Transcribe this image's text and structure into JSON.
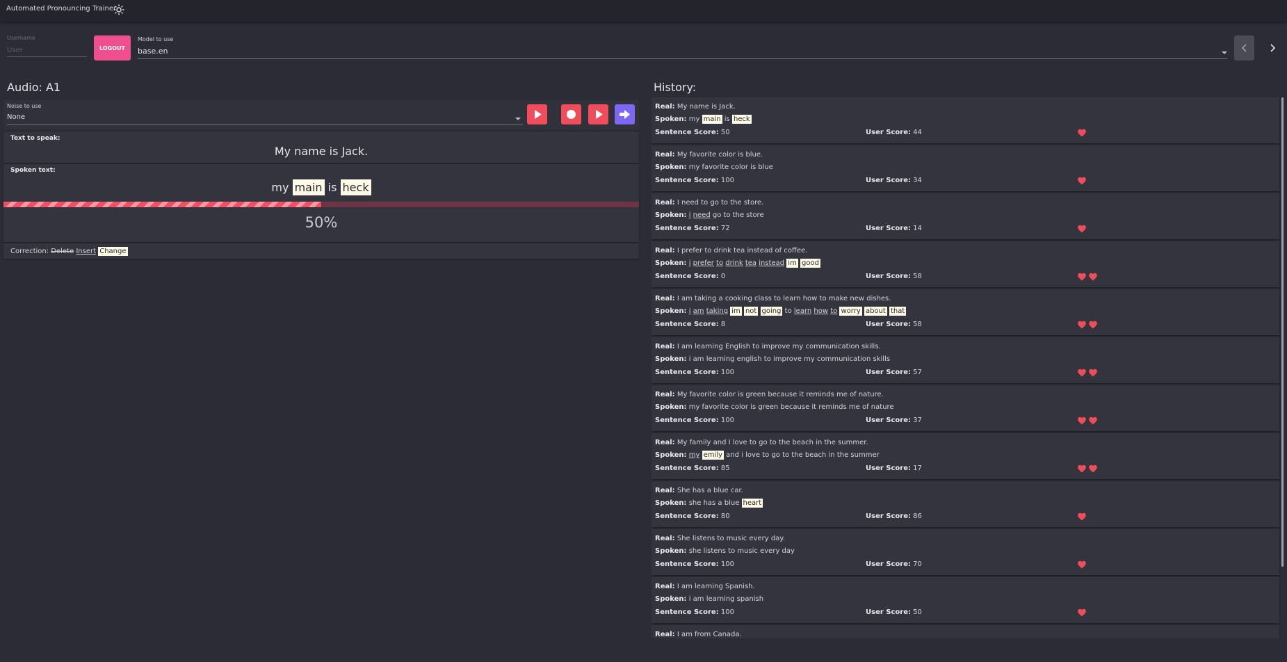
{
  "app": {
    "title": "Automated Pronouncing Trainer",
    "theme_icon": "sun-icon"
  },
  "header": {
    "username_label": "Username",
    "username_placeholder": "User",
    "logout_label": "LOGOUT",
    "model_label": "Model to use",
    "model_value": "base.en",
    "prev_icon": "chevron-left-icon",
    "next_icon": "chevron-right-icon"
  },
  "audio": {
    "title": "Audio: A1",
    "noise_label": "Noise to use",
    "noise_value": "None",
    "buttons": [
      "play-icon",
      "record-icon",
      "play-icon",
      "next-arrow-icon"
    ],
    "text_to_speak_label": "Text to speak:",
    "text_to_speak": "My name is Jack.",
    "spoken_label": "Spoken text:",
    "spoken_words": [
      {
        "text": "my",
        "style": "plain"
      },
      {
        "text": "main",
        "style": "change"
      },
      {
        "text": "is",
        "style": "plain"
      },
      {
        "text": "heck",
        "style": "change"
      }
    ],
    "progress": 50,
    "progress_label": "50%",
    "correction_label": "Correction:",
    "correction_delete": "Delete",
    "correction_insert": "Insert",
    "correction_change": "Change"
  },
  "history": {
    "title": "History:",
    "real_label": "Real:",
    "spoken_label": "Spoken:",
    "sentence_score_label": "Sentence Score:",
    "user_score_label": "User Score:",
    "colors": {
      "heart": "#f04c5c",
      "highlight": "#fffbe8"
    },
    "items": [
      {
        "real": "My name is Jack.",
        "spoken": [
          [
            "my",
            "plain"
          ],
          [
            "main",
            "change"
          ],
          [
            "is",
            "plain"
          ],
          [
            "heck",
            "change"
          ]
        ],
        "sentence_score": "50",
        "user_score": "44",
        "hearts": 1
      },
      {
        "real": "My favorite color is blue.",
        "spoken": [
          [
            "my favorite color is blue",
            "plain"
          ]
        ],
        "sentence_score": "100",
        "user_score": "34",
        "hearts": 1
      },
      {
        "real": "I need to go to the store.",
        "spoken": [
          [
            "i",
            "insert"
          ],
          [
            "need",
            "insert"
          ],
          [
            "go to the store",
            "plain"
          ]
        ],
        "sentence_score": "72",
        "user_score": "14",
        "hearts": 1
      },
      {
        "real": "I prefer to drink tea instead of coffee.",
        "spoken": [
          [
            "i",
            "insert"
          ],
          [
            "prefer",
            "insert"
          ],
          [
            "to",
            "insert"
          ],
          [
            "drink",
            "insert"
          ],
          [
            "tea",
            "insert"
          ],
          [
            "instead",
            "insert"
          ],
          [
            "im",
            "change"
          ],
          [
            "good",
            "change"
          ]
        ],
        "sentence_score": "0",
        "user_score": "58",
        "hearts": 2
      },
      {
        "real": "I am taking a cooking class to learn how to make new dishes.",
        "spoken": [
          [
            "i",
            "insert"
          ],
          [
            "am",
            "insert"
          ],
          [
            "taking",
            "insert"
          ],
          [
            "im",
            "change"
          ],
          [
            "not",
            "change"
          ],
          [
            "going",
            "change"
          ],
          [
            "to",
            "plain"
          ],
          [
            "learn",
            "insert"
          ],
          [
            "how",
            "insert"
          ],
          [
            "to",
            "insert"
          ],
          [
            "worry",
            "change"
          ],
          [
            "about",
            "change"
          ],
          [
            "that",
            "change"
          ]
        ],
        "sentence_score": "8",
        "user_score": "58",
        "hearts": 2
      },
      {
        "real": "I am learning English to improve my communication skills.",
        "spoken": [
          [
            "i am learning english to improve my communication skills",
            "plain"
          ]
        ],
        "sentence_score": "100",
        "user_score": "57",
        "hearts": 2
      },
      {
        "real": "My favorite color is green because it reminds me of nature.",
        "spoken": [
          [
            "my favorite color is green because it reminds me of nature",
            "plain"
          ]
        ],
        "sentence_score": "100",
        "user_score": "37",
        "hearts": 2
      },
      {
        "real": "My family and I love to go to the beach in the summer.",
        "spoken": [
          [
            "my",
            "insert"
          ],
          [
            "emily",
            "change"
          ],
          [
            "and i love to go to the beach in the summer",
            "plain"
          ]
        ],
        "sentence_score": "85",
        "user_score": "17",
        "hearts": 2
      },
      {
        "real": "She has a blue car.",
        "spoken": [
          [
            "she has a blue",
            "plain"
          ],
          [
            "heart",
            "change"
          ]
        ],
        "sentence_score": "80",
        "user_score": "86",
        "hearts": 1
      },
      {
        "real": "She listens to music every day.",
        "spoken": [
          [
            "she listens to music every day",
            "plain"
          ]
        ],
        "sentence_score": "100",
        "user_score": "70",
        "hearts": 1
      },
      {
        "real": "I am learning Spanish.",
        "spoken": [
          [
            "i am learning spanish",
            "plain"
          ]
        ],
        "sentence_score": "100",
        "user_score": "50",
        "hearts": 1
      },
      {
        "real": "I am from Canada.",
        "spoken": [],
        "sentence_score": "",
        "user_score": "",
        "hearts": 0
      }
    ]
  }
}
